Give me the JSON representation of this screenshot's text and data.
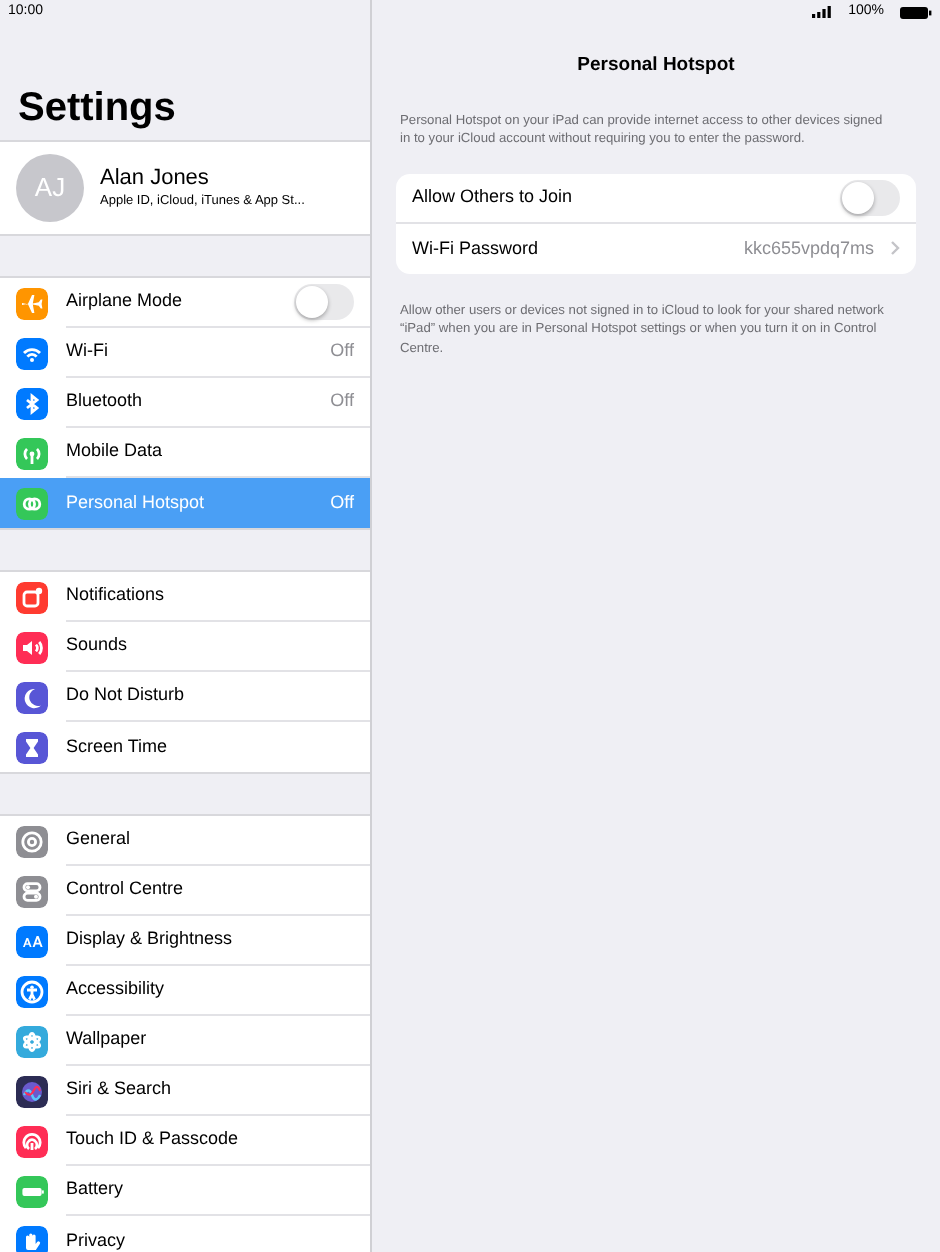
{
  "status_bar": {
    "time": "10:00",
    "battery": "100%"
  },
  "sidebar": {
    "title": "Settings",
    "profile": {
      "initials": "AJ",
      "name": "Alan Jones",
      "subtitle": "Apple ID, iCloud, iTunes & App St..."
    },
    "groups": [
      {
        "items": [
          {
            "label": "Airplane Mode",
            "kind": "switch",
            "on": false,
            "selected": false,
            "color": "#ff9500"
          },
          {
            "label": "Wi-Fi",
            "kind": "value",
            "value": "Off",
            "selected": false,
            "color": "#007aff"
          },
          {
            "label": "Bluetooth",
            "kind": "value",
            "value": "Off",
            "selected": false,
            "color": "#007aff"
          },
          {
            "label": "Mobile Data",
            "kind": "plain",
            "selected": false,
            "color": "#34c759"
          },
          {
            "label": "Personal Hotspot",
            "kind": "value",
            "value": "Off",
            "selected": true,
            "color": "#34c759"
          }
        ]
      },
      {
        "items": [
          {
            "label": "Notifications",
            "kind": "plain",
            "selected": false,
            "color": "#ff3b30"
          },
          {
            "label": "Sounds",
            "kind": "plain",
            "selected": false,
            "color": "#ff2d55"
          },
          {
            "label": "Do Not Disturb",
            "kind": "plain",
            "selected": false,
            "color": "#5856d6"
          },
          {
            "label": "Screen Time",
            "kind": "plain",
            "selected": false,
            "color": "#5856d6"
          }
        ]
      },
      {
        "items": [
          {
            "label": "General",
            "kind": "plain",
            "selected": false,
            "color": "#8e8e93"
          },
          {
            "label": "Control Centre",
            "kind": "plain",
            "selected": false,
            "color": "#8e8e93"
          },
          {
            "label": "Display & Brightness",
            "kind": "plain",
            "selected": false,
            "color": "#007aff"
          },
          {
            "label": "Accessibility",
            "kind": "plain",
            "selected": false,
            "color": "#007aff"
          },
          {
            "label": "Wallpaper",
            "kind": "plain",
            "selected": false,
            "color": "#34aadc"
          },
          {
            "label": "Siri & Search",
            "kind": "plain",
            "selected": false,
            "color": "#2c2c54"
          },
          {
            "label": "Touch ID & Passcode",
            "kind": "plain",
            "selected": false,
            "color": "#ff2d55"
          },
          {
            "label": "Battery",
            "kind": "plain",
            "selected": false,
            "color": "#34c759"
          },
          {
            "label": "Privacy",
            "kind": "plain",
            "selected": false,
            "color": "#007aff"
          }
        ]
      }
    ]
  },
  "detail": {
    "title": "Personal Hotspot",
    "header": "Personal Hotspot on your iPad can provide internet access to other devices signed in to your iCloud account without requiring you to enter the password.",
    "rows": [
      {
        "label": "Allow Others to Join",
        "kind": "switch",
        "on": false
      },
      {
        "label": "Wi-Fi Password",
        "kind": "value",
        "value": "kkc655vpdq7ms"
      }
    ],
    "footer": "Allow other users or devices not signed in to iCloud to look for your shared network “iPad” when you are in Personal Hotspot settings or when you turn it on in Control Centre."
  }
}
